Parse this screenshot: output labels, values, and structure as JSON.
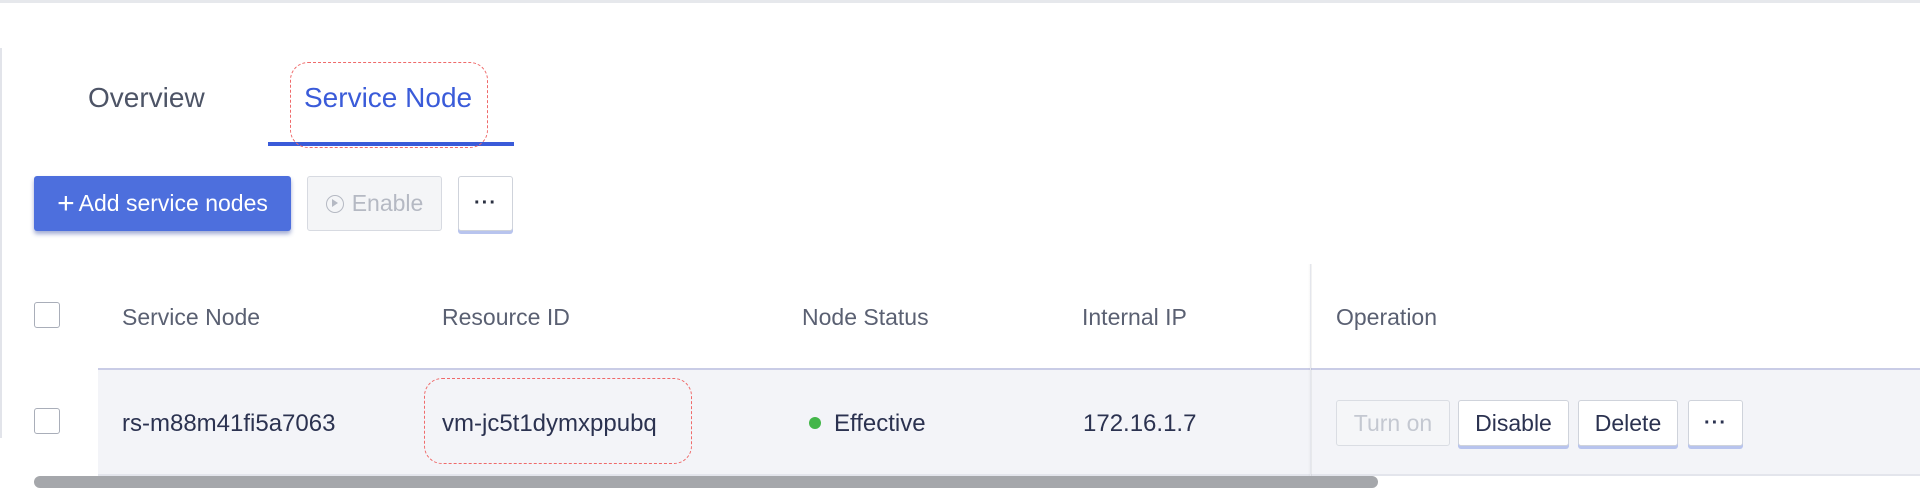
{
  "tabs": [
    {
      "label": "Overview",
      "active": false
    },
    {
      "label": "Service Node",
      "active": true
    }
  ],
  "toolbar": {
    "add_label": "Add service nodes",
    "add_icon": "plus-icon",
    "enable_label": "Enable",
    "enable_icon": "play-circle-icon",
    "more_label": "···"
  },
  "table": {
    "columns": [
      "Service Node",
      "Resource ID",
      "Node Status",
      "Internal IP",
      "Operation"
    ],
    "rows": [
      {
        "service_node": "rs-m88m41fi5a7063",
        "resource_id": "vm-jc5t1dymxppubq",
        "status": "Effective",
        "internal_ip": "172.16.1.7",
        "operations": {
          "turn_on": "Turn on",
          "disable": "Disable",
          "delete": "Delete",
          "more": "···"
        }
      }
    ]
  },
  "colors": {
    "accent": "#3a5bd9",
    "primary_button": "#4d6fdd",
    "status_effective": "#43b649",
    "annotation_dashed": "#ef6a6a"
  }
}
